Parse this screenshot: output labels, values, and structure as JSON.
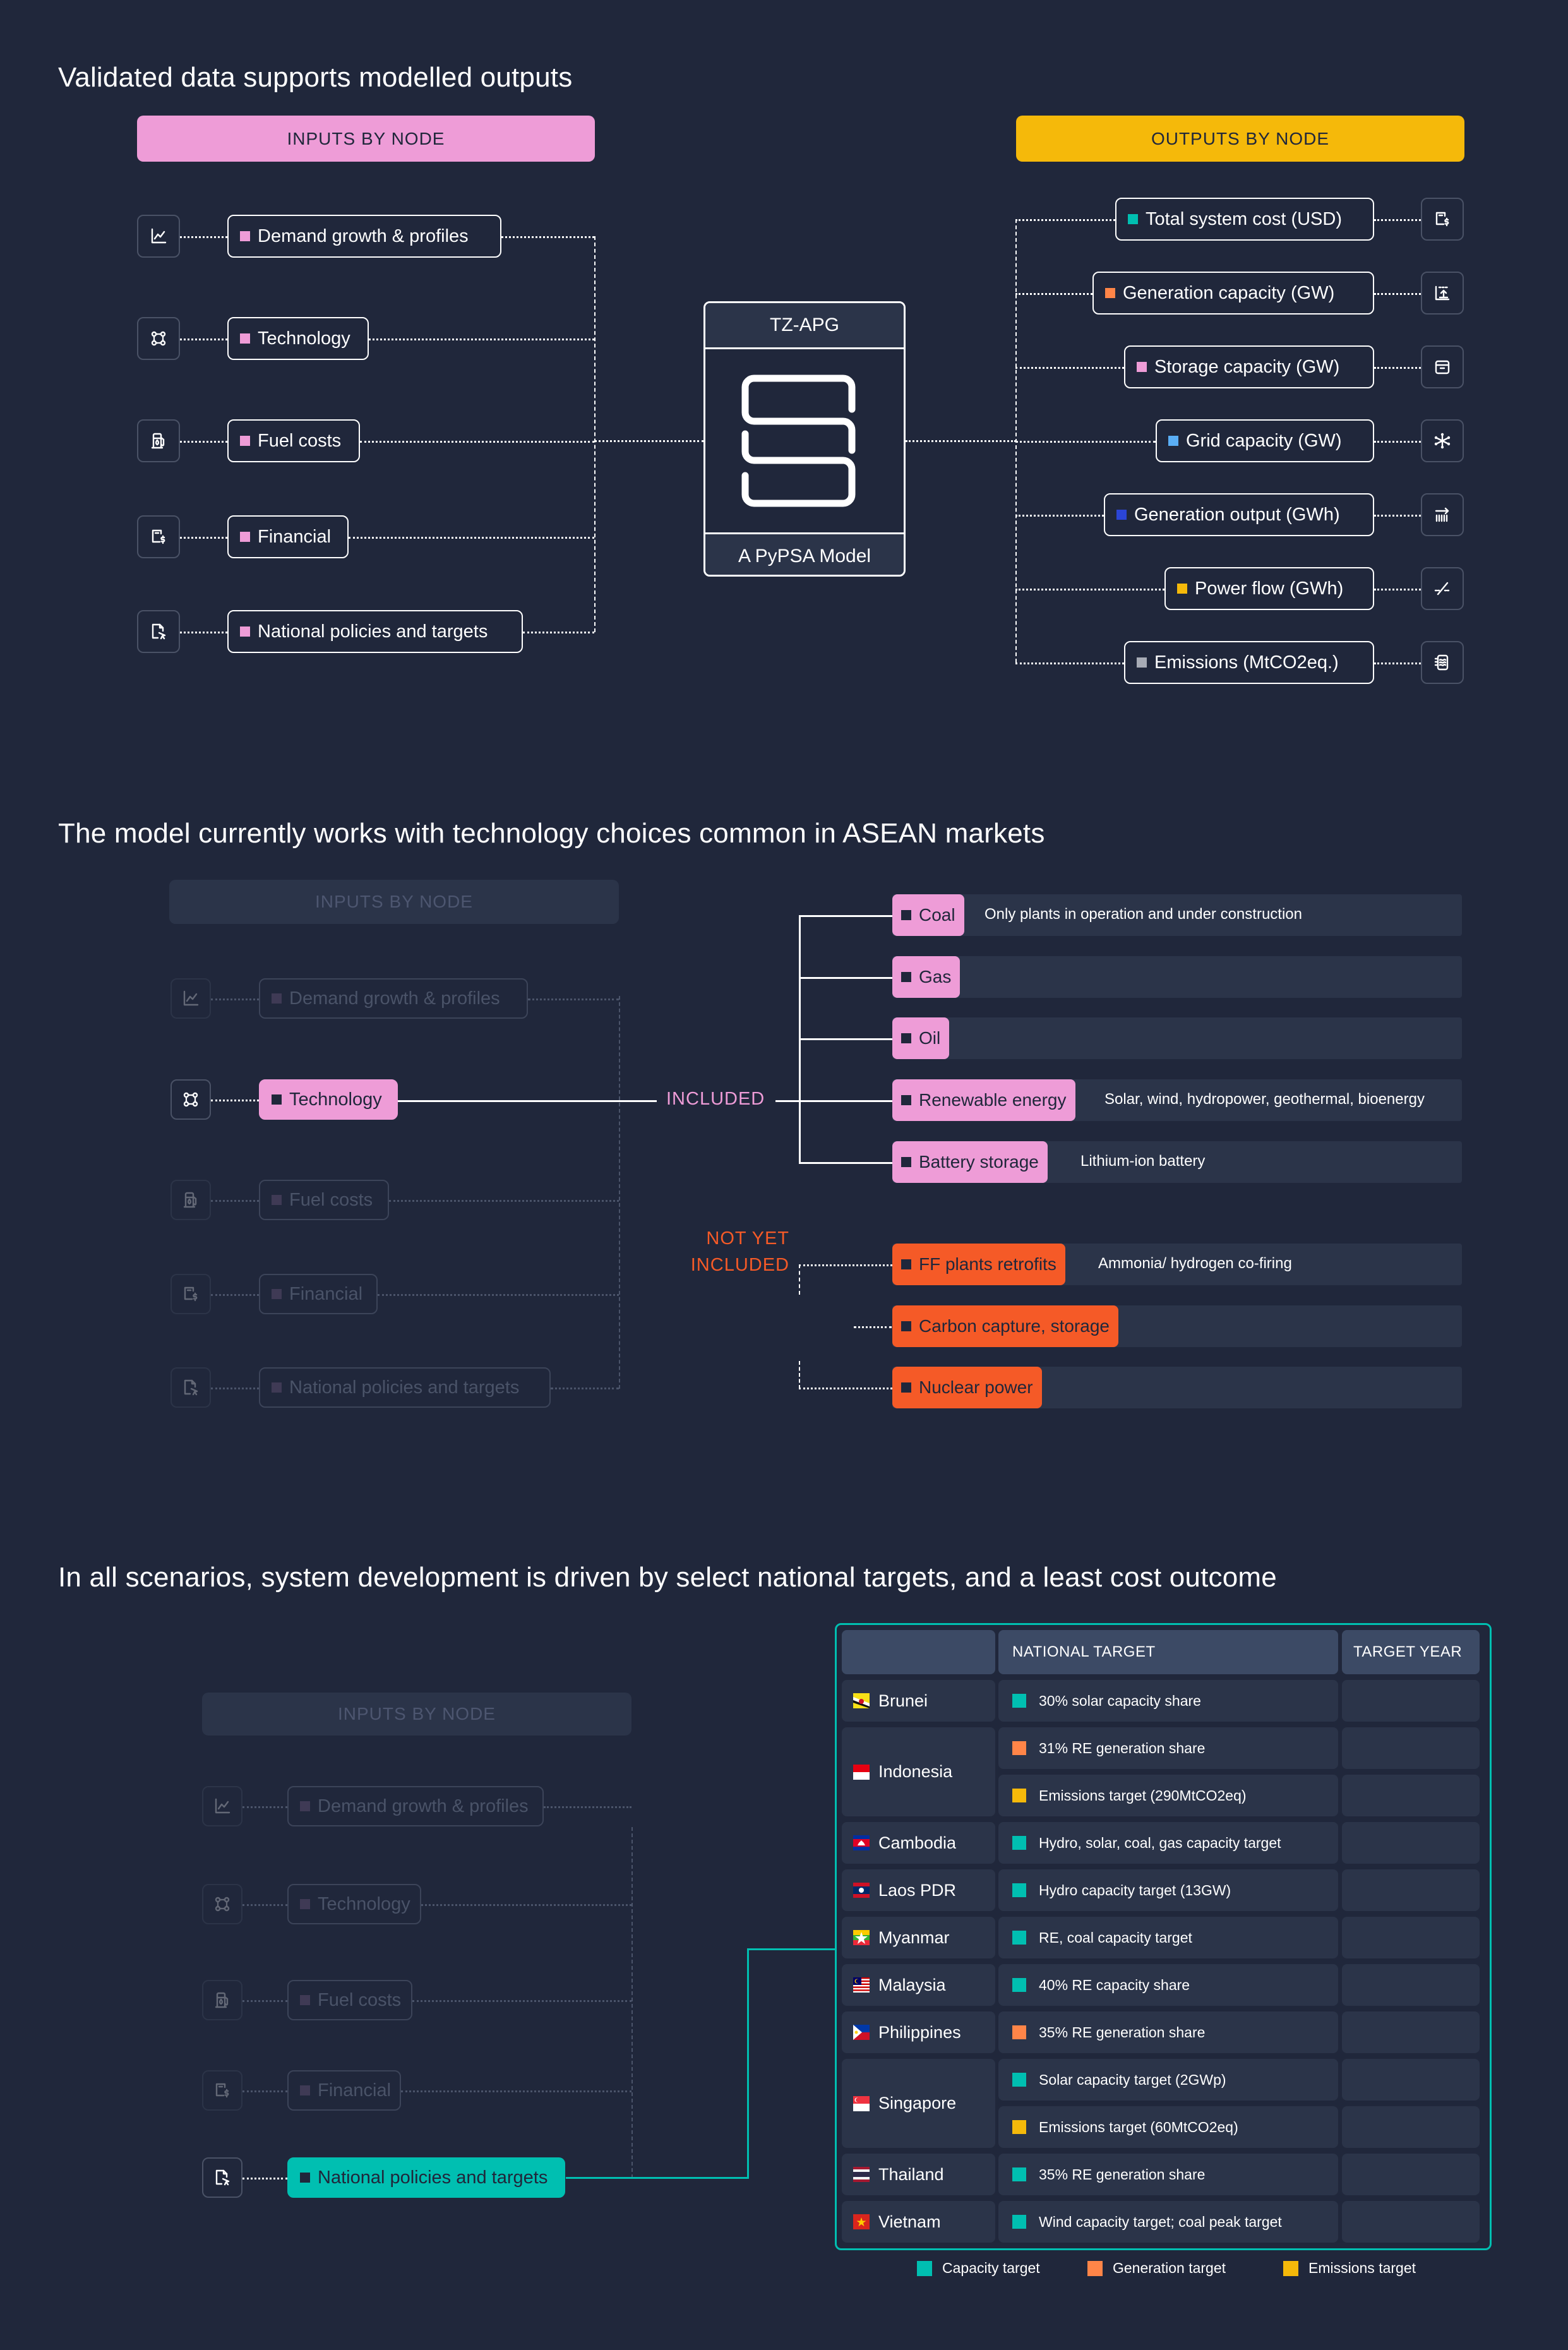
{
  "colors": {
    "background": "#20273b",
    "pink": "#ee9cd7",
    "yellow": "#f5b90a",
    "orange_red": "#f55a27",
    "teal": "#00bfb1",
    "orange": "#ff8548",
    "light_blue": "#5aaef5",
    "blue": "#2b45d6",
    "grey": "#a7abb5",
    "capacity": "#00bfb1",
    "generation": "#ff8548",
    "emissions": "#f5b90a"
  },
  "section1": {
    "title": "Validated data supports modelled outputs",
    "inputs_header": "INPUTS BY NODE",
    "outputs_header": "OUTPUTS BY NODE",
    "inputs": [
      {
        "label": "Demand growth & profiles",
        "icon": "line-chart-icon"
      },
      {
        "label": "Technology",
        "icon": "nodes-grid-icon"
      },
      {
        "label": "Fuel costs",
        "icon": "fuel-pump-icon"
      },
      {
        "label": "Financial",
        "icon": "invoice-dollar-icon"
      },
      {
        "label": "National policies and targets",
        "icon": "document-cursor-icon"
      }
    ],
    "model": {
      "name": "TZ-APG",
      "subtitle": "A PyPSA Model",
      "logo": "pypsa-s-logo-icon"
    },
    "outputs": [
      {
        "label": "Total system cost (USD)",
        "color": "#00bfb1",
        "icon": "invoice-dollar-icon"
      },
      {
        "label": "Generation capacity (GW)",
        "color": "#ff8548",
        "icon": "capacity-upload-icon"
      },
      {
        "label": "Storage capacity (GW)",
        "color": "#ee9cd7",
        "icon": "storage-box-icon"
      },
      {
        "label": "Grid capacity (GW)",
        "color": "#5aaef5",
        "icon": "network-hub-icon"
      },
      {
        "label": "Generation output (GWh)",
        "color": "#2b45d6",
        "icon": "output-arrow-bars-icon"
      },
      {
        "label": "Power flow (GWh)",
        "color": "#f5b90a",
        "icon": "power-flow-slash-icon"
      },
      {
        "label": "Emissions (MtCO2eq.)",
        "color": "#a7abb5",
        "icon": "emissions-layers-icon"
      }
    ]
  },
  "section2": {
    "title": "The model currently works with technology choices common in ASEAN markets",
    "inputs_header": "INPUTS BY NODE",
    "inputs": [
      {
        "label": "Demand growth & profiles",
        "icon": "line-chart-icon",
        "active": false
      },
      {
        "label": "Technology",
        "icon": "nodes-grid-icon",
        "active": true
      },
      {
        "label": "Fuel costs",
        "icon": "fuel-pump-icon",
        "active": false
      },
      {
        "label": "Financial",
        "icon": "invoice-dollar-icon",
        "active": false
      },
      {
        "label": "National policies and targets",
        "icon": "document-cursor-icon",
        "active": false
      }
    ],
    "included_label": "INCLUDED",
    "not_yet_label_line1": "NOT YET",
    "not_yet_label_line2": "INCLUDED",
    "included": [
      {
        "label": "Coal",
        "note": "Only plants in operation and under construction"
      },
      {
        "label": "Gas",
        "note": ""
      },
      {
        "label": "Oil",
        "note": ""
      },
      {
        "label": "Renewable energy",
        "note": "Solar, wind, hydropower, geothermal, bioenergy"
      },
      {
        "label": "Battery storage",
        "note": "Lithium-ion battery"
      }
    ],
    "not_included": [
      {
        "label": "FF plants retrofits",
        "note": "Ammonia/ hydrogen co-firing"
      },
      {
        "label": "Carbon capture, storage",
        "note": ""
      },
      {
        "label": "Nuclear power",
        "note": ""
      }
    ]
  },
  "section3": {
    "title": "In all scenarios, system development is driven by select national targets, and a least cost outcome",
    "inputs_header": "INPUTS BY NODE",
    "inputs": [
      {
        "label": "Demand growth & profiles",
        "icon": "line-chart-icon",
        "active": false
      },
      {
        "label": "Technology",
        "icon": "nodes-grid-icon",
        "active": false
      },
      {
        "label": "Fuel costs",
        "icon": "fuel-pump-icon",
        "active": false
      },
      {
        "label": "Financial",
        "icon": "invoice-dollar-icon",
        "active": false
      },
      {
        "label": "National policies and targets",
        "icon": "document-cursor-icon",
        "active": true
      }
    ],
    "table": {
      "headers": [
        "",
        "NATIONAL TARGET",
        "TARGET YEAR"
      ],
      "rows": [
        {
          "country": "Brunei",
          "flag": "brunei-flag-icon",
          "targets": [
            {
              "text": "30% solar capacity share",
              "type": "capacity",
              "year": ""
            }
          ]
        },
        {
          "country": "Indonesia",
          "flag": "indonesia-flag-icon",
          "targets": [
            {
              "text": "31% RE generation share",
              "type": "generation",
              "year": ""
            },
            {
              "text": "Emissions target (290MtCO2eq)",
              "type": "emissions",
              "year": ""
            }
          ]
        },
        {
          "country": "Cambodia",
          "flag": "cambodia-flag-icon",
          "targets": [
            {
              "text": "Hydro, solar, coal, gas capacity target",
              "type": "capacity",
              "year": ""
            }
          ]
        },
        {
          "country": "Laos PDR",
          "flag": "laos-flag-icon",
          "targets": [
            {
              "text": "Hydro capacity target (13GW)",
              "type": "capacity",
              "year": ""
            }
          ]
        },
        {
          "country": "Myanmar",
          "flag": "myanmar-flag-icon",
          "targets": [
            {
              "text": "RE, coal capacity target",
              "type": "capacity",
              "year": ""
            }
          ]
        },
        {
          "country": "Malaysia",
          "flag": "malaysia-flag-icon",
          "targets": [
            {
              "text": "40% RE capacity share",
              "type": "capacity",
              "year": ""
            }
          ]
        },
        {
          "country": "Philippines",
          "flag": "philippines-flag-icon",
          "targets": [
            {
              "text": "35% RE generation share",
              "type": "generation",
              "year": ""
            }
          ]
        },
        {
          "country": "Singapore",
          "flag": "singapore-flag-icon",
          "targets": [
            {
              "text": "Solar capacity target (2GWp)",
              "type": "capacity",
              "year": ""
            },
            {
              "text": "Emissions target (60MtCO2eq)",
              "type": "emissions",
              "year": ""
            }
          ]
        },
        {
          "country": "Thailand",
          "flag": "thailand-flag-icon",
          "targets": [
            {
              "text": "35% RE generation share",
              "type": "capacity",
              "year": ""
            }
          ]
        },
        {
          "country": "Vietnam",
          "flag": "vietnam-flag-icon",
          "targets": [
            {
              "text": "Wind capacity target; coal peak target",
              "type": "capacity",
              "year": ""
            }
          ]
        }
      ]
    },
    "legend": [
      {
        "label": "Capacity target",
        "type": "capacity"
      },
      {
        "label": "Generation target",
        "type": "generation"
      },
      {
        "label": "Emissions target",
        "type": "emissions"
      }
    ]
  }
}
